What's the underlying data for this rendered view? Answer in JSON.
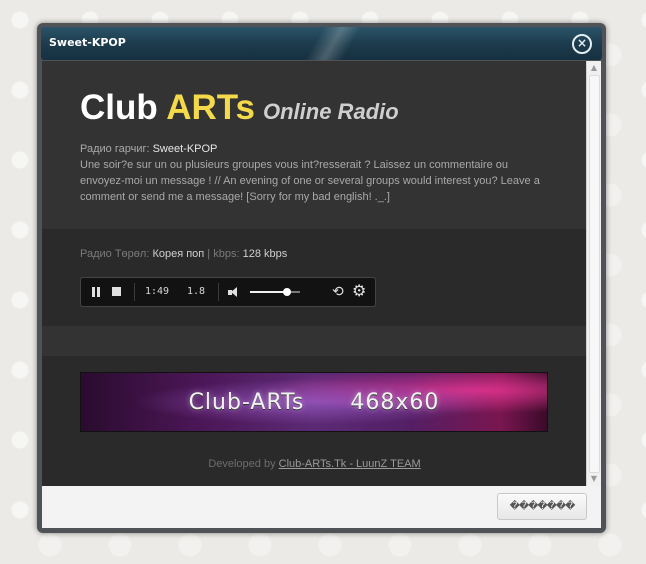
{
  "window": {
    "title": "Sweet-KPOP",
    "close_glyph": "×"
  },
  "logo": {
    "part1": "Club ",
    "part2": "ARTs",
    "part3": "Online Radio",
    "colors": {
      "white": "#ffffff",
      "accent": "#f4d94a",
      "subtitle": "#cfcfcf"
    }
  },
  "description": {
    "label": "Радио гарчиг: ",
    "station": "Sweet-KPOP",
    "text": "Une soir?e sur un ou plusieurs groupes vous int?resserait ? Laissez un commentaire ou envoyez-moi un message ! // An evening of one or several groups would interest you? Leave a comment or send me a message! [Sorry for my bad english! ._.]"
  },
  "station_info": {
    "genre_label": "Радио Төрөл: ",
    "genre_value": "Корея поп",
    "separator": " | ",
    "kbps_label": "kbps: ",
    "kbps_value": "128 kbps"
  },
  "player": {
    "time": "1:49",
    "rate": "1.8",
    "volume_fraction": 0.74,
    "icons": [
      "pause-icon",
      "stop-icon",
      "volume-icon",
      "repeat-icon",
      "gear-icon"
    ],
    "repeat_glyph": "⟲",
    "gear_glyph": "⚙"
  },
  "banner": {
    "left": "Club-ARTs",
    "right": "468x60"
  },
  "credits": {
    "prefix": "Developed by ",
    "link_text": "Club-ARTs.Tk - LuunZ TEAM"
  },
  "footer": {
    "button_label": "�������"
  },
  "scrollbar": {
    "up_glyph": "▲",
    "down_glyph": "▼"
  }
}
